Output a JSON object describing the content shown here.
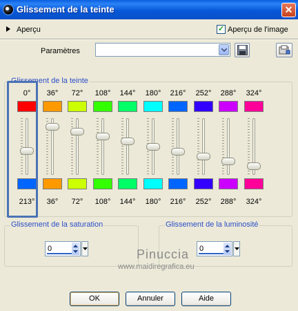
{
  "window": {
    "title": "Glissement de la teinte",
    "close_label": "✕"
  },
  "preview": {
    "label": "Aperçu",
    "checkbox_label": "Aperçu de l'image",
    "checked": true,
    "check_mark": "✓"
  },
  "params": {
    "label": "Paramètres",
    "value": ""
  },
  "hue_group": {
    "legend": "Glissement de la teinte",
    "columns": [
      {
        "top": "0°",
        "bottom": "213°",
        "from_color": "#ff0000",
        "to_color": "#0066ff",
        "slider_value": 213
      },
      {
        "top": "36°",
        "bottom": "36°",
        "from_color": "#ff9900",
        "to_color": "#ff9900",
        "slider_value": 36
      },
      {
        "top": "72°",
        "bottom": "72°",
        "from_color": "#ccff00",
        "to_color": "#ccff00",
        "slider_value": 72
      },
      {
        "top": "108°",
        "bottom": "108°",
        "from_color": "#33ff00",
        "to_color": "#33ff00",
        "slider_value": 108
      },
      {
        "top": "144°",
        "bottom": "144°",
        "from_color": "#00ff66",
        "to_color": "#00ff66",
        "slider_value": 144
      },
      {
        "top": "180°",
        "bottom": "180°",
        "from_color": "#00ffff",
        "to_color": "#00ffff",
        "slider_value": 180
      },
      {
        "top": "216°",
        "bottom": "216°",
        "from_color": "#0066ff",
        "to_color": "#0066ff",
        "slider_value": 216
      },
      {
        "top": "252°",
        "bottom": "252°",
        "from_color": "#3300ff",
        "to_color": "#3300ff",
        "slider_value": 252
      },
      {
        "top": "288°",
        "bottom": "288°",
        "from_color": "#cc00ff",
        "to_color": "#cc00ff",
        "slider_value": 288
      },
      {
        "top": "324°",
        "bottom": "324°",
        "from_color": "#ff0099",
        "to_color": "#ff0099",
        "slider_value": 324
      }
    ]
  },
  "saturation": {
    "legend": "Glissement de la saturation",
    "value": "0"
  },
  "luminosity": {
    "legend": "Glissement de la luminosité",
    "value": "0"
  },
  "watermark": {
    "name": "Pinuccia",
    "site": "www.maidiregrafica.eu"
  },
  "buttons": {
    "ok": "OK",
    "cancel": "Annuler",
    "help": "Aide"
  },
  "colors": {
    "accent": "#4b72b5",
    "title_bar": "#0a5fe0",
    "legend_text": "#2c4ec8"
  }
}
